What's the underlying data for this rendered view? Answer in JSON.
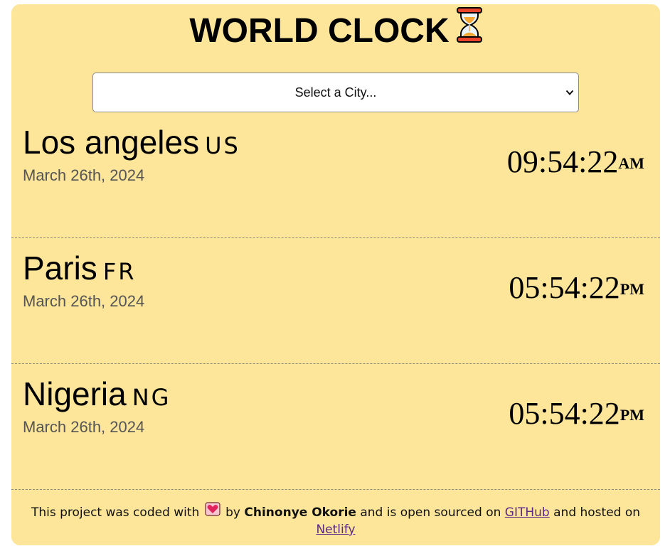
{
  "header": {
    "title": "WORLD CLOCK",
    "title_icon": "hourglass-icon"
  },
  "city_select": {
    "selected_label": "Select a City...",
    "chevron_icon": "chevron-down-icon"
  },
  "cities": [
    {
      "name": "Los angeles",
      "country": "US",
      "date": "March 26th, 2024",
      "time": "09:54:22",
      "ampm": "AM"
    },
    {
      "name": "Paris",
      "country": "FR",
      "date": "March 26th, 2024",
      "time": "05:54:22",
      "ampm": "PM"
    },
    {
      "name": "Nigeria",
      "country": "NG",
      "date": "March 26th, 2024",
      "time": "05:54:22",
      "ampm": "PM"
    }
  ],
  "footer": {
    "text_before": "This project was coded with",
    "heart_icon": "heart-icon",
    "text_by": "by",
    "author": "Chinonye Okorie",
    "text_middle": "and is open sourced on",
    "github_link": "GITHub",
    "text_hosted": "and hosted on",
    "netlify_link": "Netlify"
  },
  "colors": {
    "card_background": "#fde59a",
    "link": "#5b2a86"
  }
}
